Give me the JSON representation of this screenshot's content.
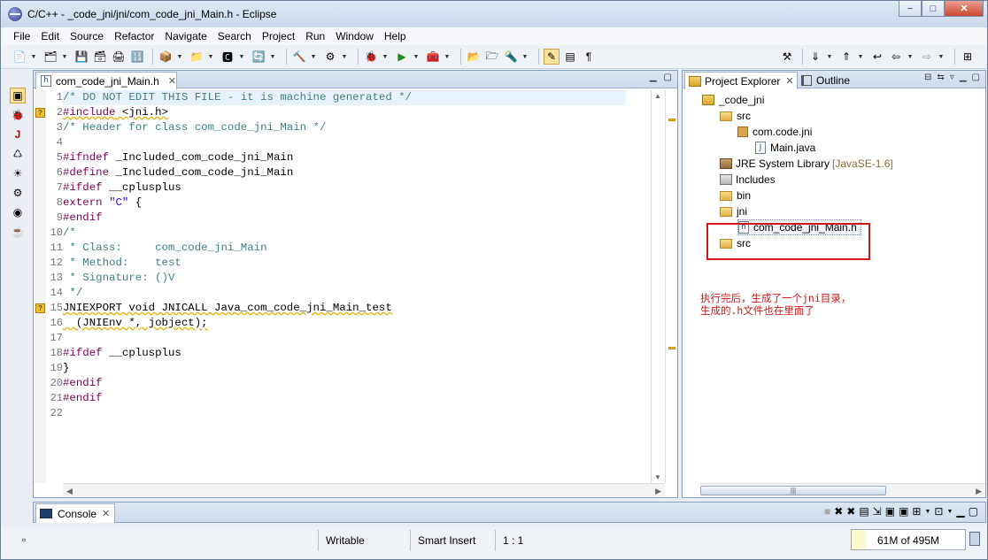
{
  "window": {
    "title": "C/C++ - _code_jni/jni/com_code_jni_Main.h - Eclipse",
    "buttons": {
      "minimize": "−",
      "maximize": "□",
      "close": "✕"
    }
  },
  "menu": [
    "File",
    "Edit",
    "Source",
    "Refactor",
    "Navigate",
    "Search",
    "Project",
    "Run",
    "Window",
    "Help"
  ],
  "editor": {
    "tab_label": "com_code_jni_Main.h",
    "lines": [
      {
        "n": "1",
        "segs": [
          {
            "t": "/* DO NOT EDIT THIS FILE - it is machine generated */",
            "c": "cmt"
          }
        ],
        "cur": true
      },
      {
        "n": "2",
        "segs": [
          {
            "t": "#include",
            "c": "kw"
          },
          {
            "t": " <jni.h>",
            "c": ""
          }
        ],
        "warn": true,
        "squig": true
      },
      {
        "n": "3",
        "segs": [
          {
            "t": "/* Header for class com_code_jni_Main */",
            "c": "cmt"
          }
        ]
      },
      {
        "n": "4",
        "segs": [
          {
            "t": "",
            "c": ""
          }
        ]
      },
      {
        "n": "5",
        "segs": [
          {
            "t": "#ifndef",
            "c": "kw"
          },
          {
            "t": " _Included_com_code_jni_Main",
            "c": ""
          }
        ]
      },
      {
        "n": "6",
        "segs": [
          {
            "t": "#define",
            "c": "kw"
          },
          {
            "t": " _Included_com_code_jni_Main",
            "c": ""
          }
        ]
      },
      {
        "n": "7",
        "segs": [
          {
            "t": "#ifdef",
            "c": "kw"
          },
          {
            "t": " __cplusplus",
            "c": ""
          }
        ]
      },
      {
        "n": "8",
        "segs": [
          {
            "t": "extern",
            "c": "kw"
          },
          {
            "t": " ",
            "c": ""
          },
          {
            "t": "\"C\"",
            "c": "str"
          },
          {
            "t": " {",
            "c": ""
          }
        ]
      },
      {
        "n": "9",
        "segs": [
          {
            "t": "#endif",
            "c": "kw"
          }
        ]
      },
      {
        "n": "10",
        "segs": [
          {
            "t": "/*",
            "c": "cmt"
          }
        ]
      },
      {
        "n": "11",
        "segs": [
          {
            "t": " * Class:     com_code_jni_Main",
            "c": "cmt"
          }
        ]
      },
      {
        "n": "12",
        "segs": [
          {
            "t": " * Method:    test",
            "c": "cmt"
          }
        ]
      },
      {
        "n": "13",
        "segs": [
          {
            "t": " * Signature: ()V",
            "c": "cmt"
          }
        ]
      },
      {
        "n": "14",
        "segs": [
          {
            "t": " */",
            "c": "cmt"
          }
        ]
      },
      {
        "n": "15",
        "segs": [
          {
            "t": "JNIEXPORT void JNICALL Java_com_code_jni_Main_test",
            "c": ""
          }
        ],
        "warn": true,
        "squig": true
      },
      {
        "n": "16",
        "segs": [
          {
            "t": "  (JNIEnv *, jobject);",
            "c": ""
          }
        ],
        "squig": true
      },
      {
        "n": "17",
        "segs": [
          {
            "t": "",
            "c": ""
          }
        ]
      },
      {
        "n": "18",
        "segs": [
          {
            "t": "#ifdef",
            "c": "kw"
          },
          {
            "t": " __cplusplus",
            "c": ""
          }
        ]
      },
      {
        "n": "19",
        "segs": [
          {
            "t": "}",
            "c": ""
          }
        ]
      },
      {
        "n": "20",
        "segs": [
          {
            "t": "#endif",
            "c": "kw"
          }
        ]
      },
      {
        "n": "21",
        "segs": [
          {
            "t": "#endif",
            "c": "kw"
          }
        ]
      },
      {
        "n": "22",
        "segs": [
          {
            "t": "",
            "c": ""
          }
        ]
      }
    ]
  },
  "project_explorer": {
    "tab_label": "Project Explorer",
    "outline_label": "Outline",
    "tree": {
      "project": "_code_jni",
      "src": "src",
      "package": "com.code.jni",
      "main_java": "Main.java",
      "jre": "JRE System Library",
      "jre_version": "[JavaSE-1.6]",
      "includes": "Includes",
      "bin": "bin",
      "jni": "jni",
      "header": "com_code_jni_Main.h",
      "src2": "src"
    },
    "annotation_line1": "执行完后，生成了一个jni目录，",
    "annotation_line2": "生成的.h文件也在里面了"
  },
  "console": {
    "tab_label": "Console"
  },
  "status_bar": {
    "writable": "Writable",
    "insert_mode": "Smart Insert",
    "position": "1 : 1",
    "heap": "61M of 495M",
    "heap_used_fraction": 0.12
  },
  "colors": {
    "comment": "#3f7f7f",
    "keyword": "#7f0055",
    "string": "#2a00ff",
    "annotation": "#d01818"
  }
}
